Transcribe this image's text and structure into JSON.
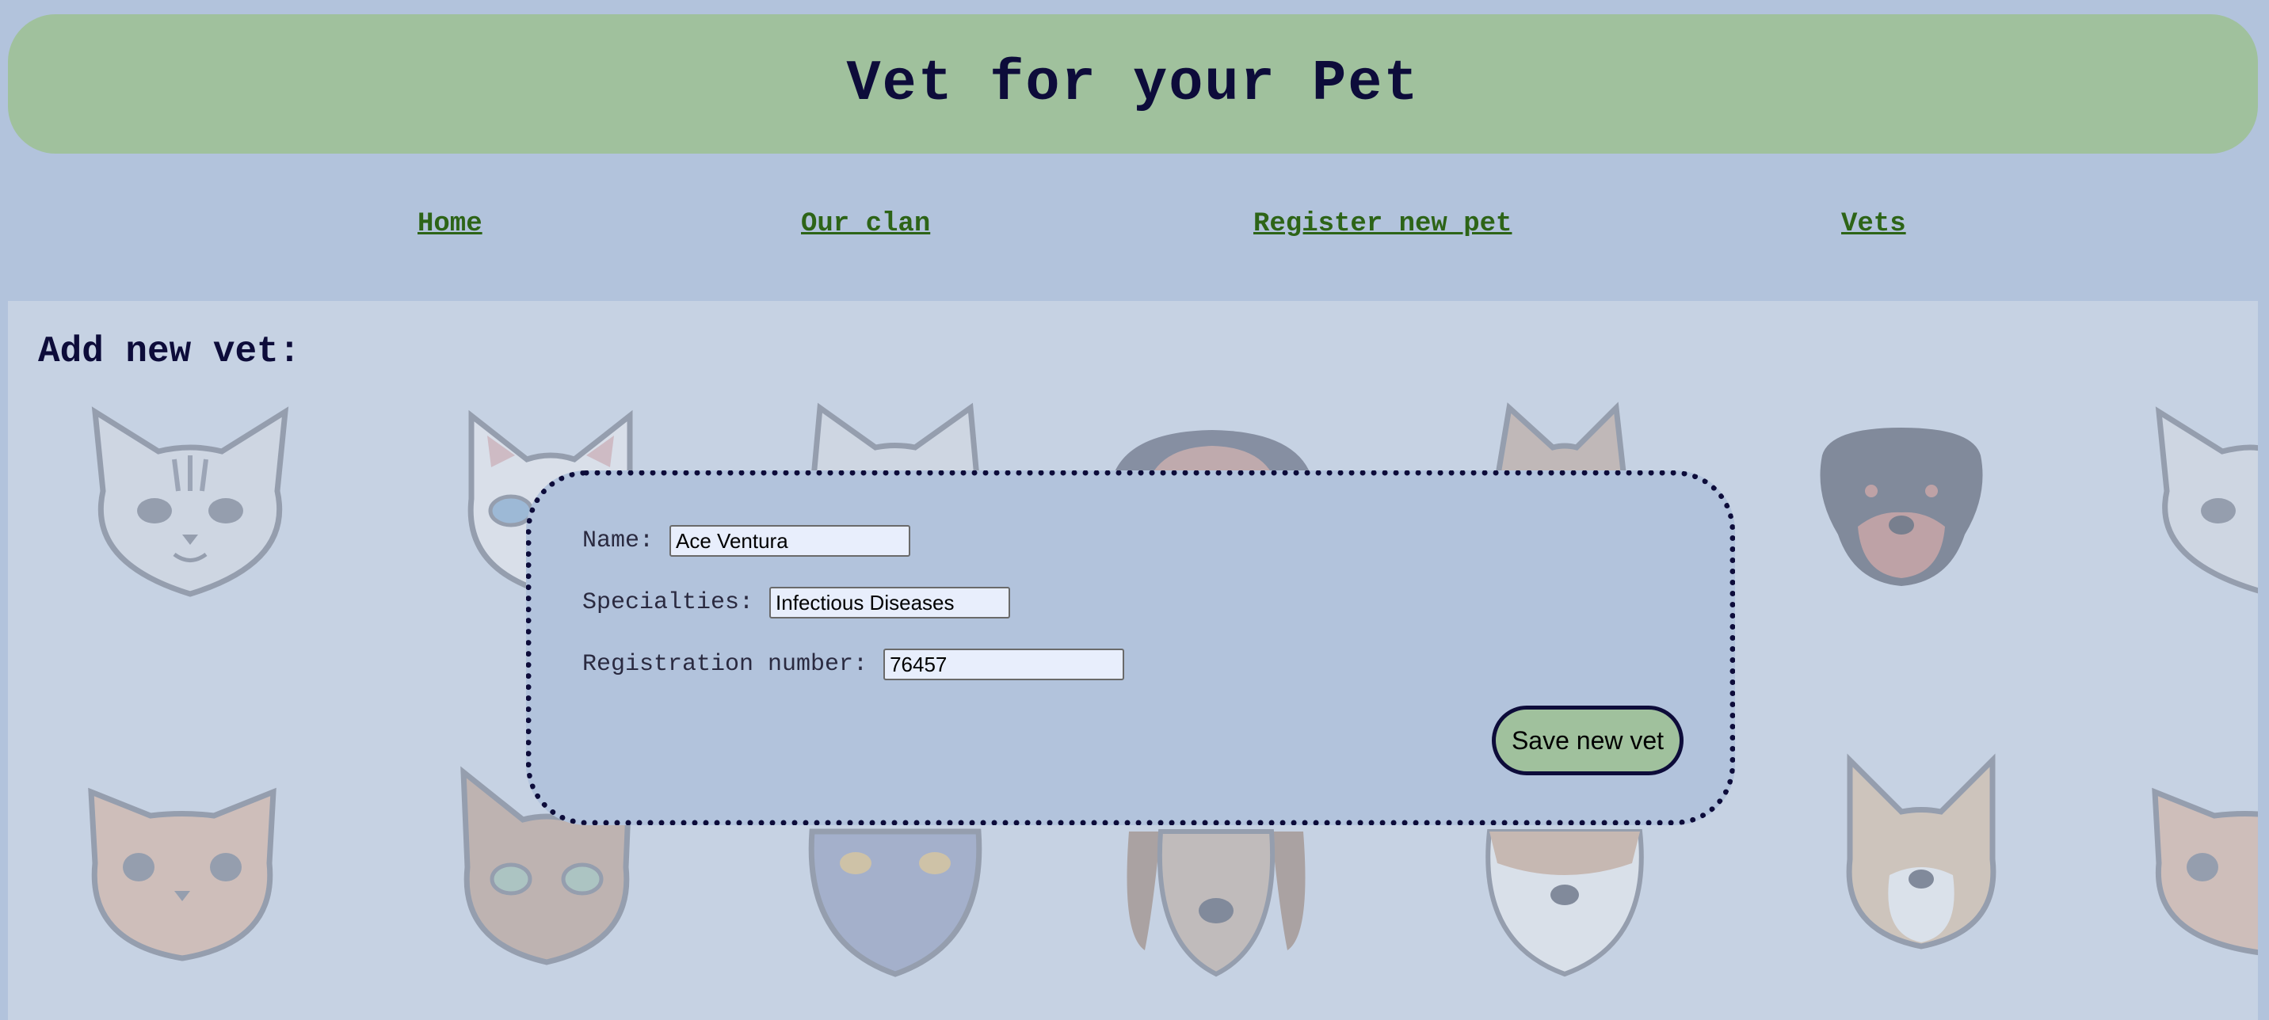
{
  "header": {
    "title": "Vet for your Pet"
  },
  "nav": {
    "items": [
      "Home",
      "Our clan",
      "Register new pet",
      "Vets"
    ]
  },
  "page": {
    "heading": "Add new vet:"
  },
  "form": {
    "name_label": "Name:",
    "name_value": "Ace Ventura",
    "specialties_label": "Specialties:",
    "specialties_value": "Infectious Diseases",
    "registration_label": "Registration number:",
    "registration_value": "76457",
    "save_label": "Save new vet"
  },
  "colors": {
    "page_background": "#b2c3dc",
    "header_background": "#a0c19d",
    "title_text": "#0d0c3a",
    "nav_link": "#2d6417",
    "content_background": "#c6d2e3",
    "button_background": "#a0c19d"
  }
}
